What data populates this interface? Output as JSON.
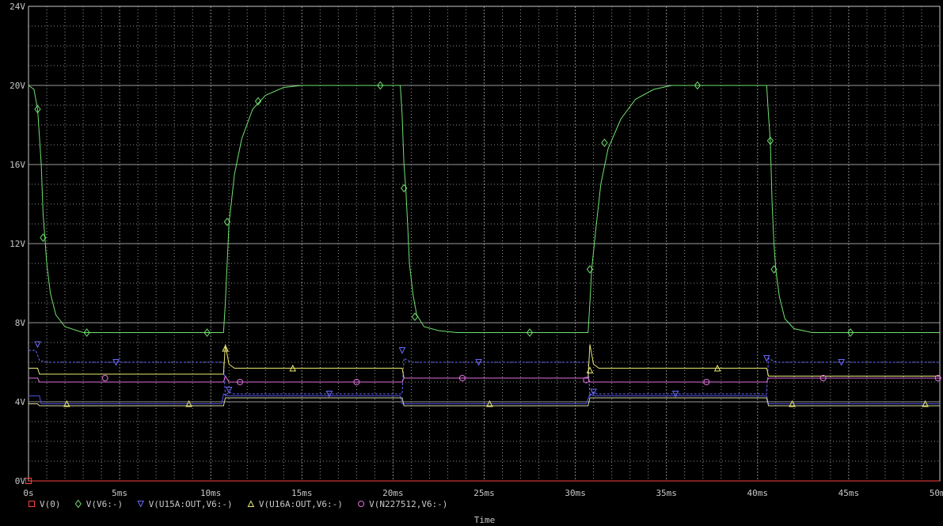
{
  "chart_data": {
    "type": "line",
    "xlabel": "Time",
    "x_unit": "ms",
    "xlim": [
      0,
      50
    ],
    "ylim": [
      0,
      24
    ],
    "grid": true,
    "legend_placement": "bottom-left",
    "x_ticks": [
      "0s",
      "5ms",
      "10ms",
      "15ms",
      "20ms",
      "25ms",
      "30ms",
      "35ms",
      "40ms",
      "45ms",
      "50ms"
    ],
    "y_ticks": [
      {
        "value": 0,
        "label": "0V"
      },
      {
        "value": 4,
        "label": "4V"
      },
      {
        "value": 8,
        "label": "8V"
      },
      {
        "value": 12,
        "label": "12V"
      },
      {
        "value": 16,
        "label": "16V"
      },
      {
        "value": 20,
        "label": "20V"
      },
      {
        "value": 24,
        "label": "24V"
      }
    ],
    "series": [
      {
        "name": "V(0)",
        "color": "#ff4040",
        "marker": "square",
        "dashed": false,
        "points": [
          [
            0,
            0
          ],
          [
            50,
            0
          ]
        ],
        "markers": [
          [
            0,
            0
          ]
        ]
      },
      {
        "name": "V(V6:-)",
        "color": "#70e070",
        "marker": "diamond",
        "dashed": false,
        "points": [
          [
            0,
            20
          ],
          [
            0.3,
            19.8
          ],
          [
            0.5,
            18.8
          ],
          [
            0.7,
            16
          ],
          [
            0.8,
            13.5
          ],
          [
            0.9,
            12.3
          ],
          [
            1.0,
            11
          ],
          [
            1.2,
            9.5
          ],
          [
            1.5,
            8.4
          ],
          [
            2.0,
            7.8
          ],
          [
            3,
            7.5
          ],
          [
            10.7,
            7.5
          ],
          [
            10.8,
            9
          ],
          [
            10.9,
            11
          ],
          [
            11.0,
            13
          ],
          [
            11.3,
            15.5
          ],
          [
            11.7,
            17.3
          ],
          [
            12.3,
            18.8
          ],
          [
            13,
            19.5
          ],
          [
            14,
            19.9
          ],
          [
            15,
            20
          ],
          [
            20.4,
            20
          ],
          [
            20.5,
            18.5
          ],
          [
            20.6,
            16
          ],
          [
            20.7,
            14.8
          ],
          [
            20.8,
            13
          ],
          [
            20.9,
            11
          ],
          [
            21.1,
            9.4
          ],
          [
            21.3,
            8.4
          ],
          [
            21.7,
            7.8
          ],
          [
            22.5,
            7.6
          ],
          [
            23.5,
            7.5
          ],
          [
            30.7,
            7.5
          ],
          [
            30.8,
            9
          ],
          [
            30.9,
            10.7
          ],
          [
            31.1,
            12.5
          ],
          [
            31.4,
            15
          ],
          [
            31.8,
            16.8
          ],
          [
            32.5,
            18.3
          ],
          [
            33.3,
            19.3
          ],
          [
            34.3,
            19.8
          ],
          [
            35.3,
            20
          ],
          [
            40.5,
            20
          ],
          [
            40.6,
            18.5
          ],
          [
            40.7,
            17.2
          ],
          [
            40.8,
            14
          ],
          [
            40.9,
            12
          ],
          [
            41.0,
            10.7
          ],
          [
            41.2,
            9.3
          ],
          [
            41.5,
            8.2
          ],
          [
            42.0,
            7.7
          ],
          [
            43,
            7.5
          ],
          [
            50,
            7.5
          ]
        ],
        "markers": [
          [
            0.5,
            18.8
          ],
          [
            0.8,
            12.3
          ],
          [
            3.2,
            7.5
          ],
          [
            9.8,
            7.5
          ],
          [
            10.9,
            13.1
          ],
          [
            12.6,
            19.2
          ],
          [
            19.3,
            20
          ],
          [
            20.6,
            14.8
          ],
          [
            21.2,
            8.3
          ],
          [
            27.5,
            7.5
          ],
          [
            30.8,
            10.7
          ],
          [
            31.6,
            17.1
          ],
          [
            36.7,
            20
          ],
          [
            40.7,
            17.2
          ],
          [
            40.9,
            10.7
          ],
          [
            45.1,
            7.5
          ]
        ]
      },
      {
        "name": "V(U15A:OUT,V6:-)",
        "color": "#6a6aff",
        "marker": "triangle-down",
        "dashed": true,
        "secondary": {
          "color": "#5050e0",
          "points": [
            [
              0,
              4.3
            ],
            [
              0.6,
              4.3
            ],
            [
              0.7,
              3.9
            ],
            [
              10.6,
              3.9
            ],
            [
              10.7,
              4.4
            ],
            [
              10.9,
              4.3
            ],
            [
              20.4,
              4.3
            ],
            [
              20.5,
              3.9
            ],
            [
              30.6,
              3.9
            ],
            [
              30.8,
              4.4
            ],
            [
              31,
              4.3
            ],
            [
              40.5,
              4.3
            ],
            [
              40.6,
              3.9
            ],
            [
              50,
              3.9
            ]
          ]
        },
        "points": [
          [
            0,
            6.6
          ],
          [
            0.4,
            6.6
          ],
          [
            0.6,
            6.1
          ],
          [
            1.0,
            6.0
          ],
          [
            10.7,
            6.0
          ],
          [
            10.8,
            4.3
          ],
          [
            11.0,
            4.5
          ],
          [
            11.2,
            4.4
          ],
          [
            20.5,
            4.4
          ],
          [
            20.6,
            6.2
          ],
          [
            21,
            6.0
          ],
          [
            30.7,
            6.0
          ],
          [
            30.8,
            4.3
          ],
          [
            31,
            4.5
          ],
          [
            31.2,
            4.4
          ],
          [
            40.5,
            4.4
          ],
          [
            40.6,
            6.2
          ],
          [
            41,
            6.0
          ],
          [
            50,
            6.0
          ]
        ],
        "markers": [
          [
            0.5,
            6.9
          ],
          [
            4.8,
            6.0
          ],
          [
            11.0,
            4.6
          ],
          [
            16.5,
            4.4
          ],
          [
            20.5,
            6.6
          ],
          [
            24.7,
            6.0
          ],
          [
            31.0,
            4.5
          ],
          [
            35.5,
            4.4
          ],
          [
            40.5,
            6.2
          ],
          [
            44.6,
            6.0
          ]
        ]
      },
      {
        "name": "V(U16A:OUT,V6:-)",
        "color": "#e8e870",
        "marker": "triangle-up",
        "dashed": false,
        "points": [
          [
            0,
            5.7
          ],
          [
            0.5,
            5.7
          ],
          [
            0.6,
            5.4
          ],
          [
            10.7,
            5.4
          ],
          [
            10.8,
            6.9
          ],
          [
            11.0,
            5.9
          ],
          [
            11.3,
            5.7
          ],
          [
            20.5,
            5.7
          ],
          [
            20.6,
            5.2
          ],
          [
            30.7,
            5.2
          ],
          [
            30.8,
            6.9
          ],
          [
            31,
            5.9
          ],
          [
            31.3,
            5.7
          ],
          [
            40.5,
            5.7
          ],
          [
            40.6,
            5.3
          ],
          [
            50,
            5.3
          ]
        ],
        "secondary": {
          "color": "#d8d8a0",
          "points": [
            [
              0,
              3.9
            ],
            [
              0.5,
              3.9
            ],
            [
              0.6,
              3.8
            ],
            [
              10.7,
              3.8
            ],
            [
              10.8,
              4.2
            ],
            [
              20.5,
              4.2
            ],
            [
              20.6,
              3.8
            ],
            [
              30.7,
              3.8
            ],
            [
              30.8,
              4.2
            ],
            [
              40.5,
              4.2
            ],
            [
              40.6,
              3.8
            ],
            [
              50,
              3.8
            ]
          ]
        },
        "markers": [
          [
            2.1,
            3.9
          ],
          [
            8.8,
            3.9
          ],
          [
            10.8,
            6.7
          ],
          [
            14.5,
            5.7
          ],
          [
            25.3,
            3.9
          ],
          [
            30.8,
            5.6
          ],
          [
            37.8,
            5.7
          ],
          [
            41.9,
            3.9
          ],
          [
            49.2,
            3.9
          ]
        ]
      },
      {
        "name": "V(N227512,V6:-)",
        "color": "#e070e0",
        "marker": "circle",
        "dashed": false,
        "points": [
          [
            0,
            5.2
          ],
          [
            0.5,
            5.2
          ],
          [
            0.6,
            5.0
          ],
          [
            10.7,
            5.0
          ],
          [
            10.8,
            5.3
          ],
          [
            11.0,
            5.0
          ],
          [
            20.5,
            5.0
          ],
          [
            20.6,
            5.2
          ],
          [
            30.7,
            5.2
          ],
          [
            30.8,
            5.0
          ],
          [
            40.5,
            5.0
          ],
          [
            40.6,
            5.2
          ],
          [
            50,
            5.2
          ]
        ],
        "markers": [
          [
            4.2,
            5.2
          ],
          [
            11.6,
            5.0
          ],
          [
            18.0,
            5.0
          ],
          [
            23.8,
            5.2
          ],
          [
            30.6,
            5.1
          ],
          [
            37.2,
            5.0
          ],
          [
            43.6,
            5.2
          ],
          [
            49.9,
            5.2
          ]
        ]
      }
    ]
  }
}
